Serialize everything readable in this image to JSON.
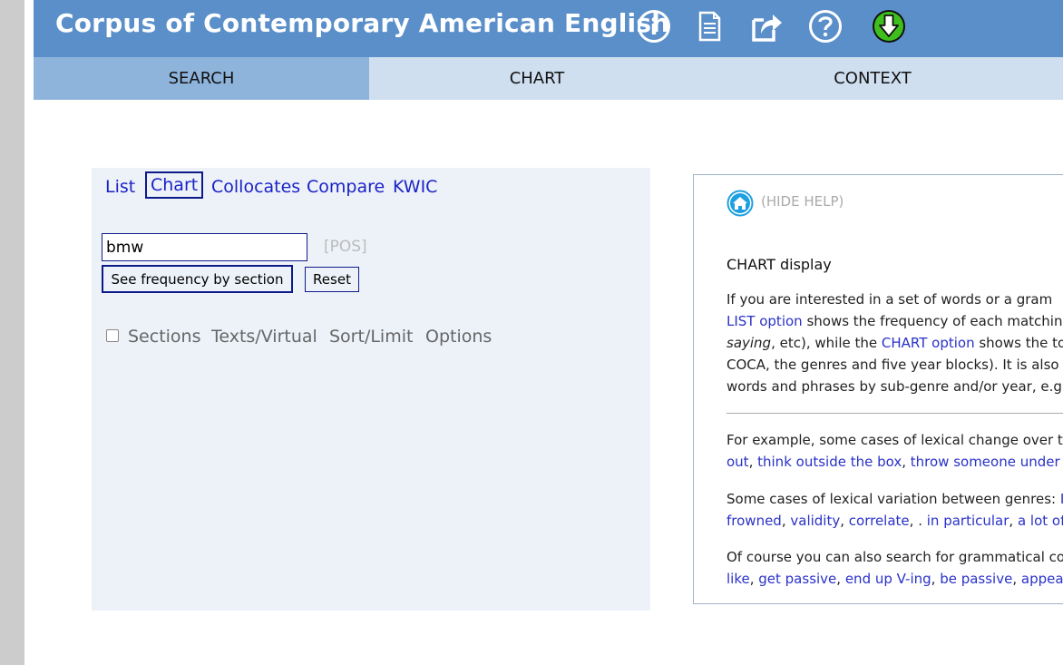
{
  "colors": {
    "header_bg": "#5a8fc9",
    "tab_bg": "#cfdff0",
    "tab_active_bg": "#8eb4dc",
    "panel_bg": "#edf2f9",
    "link": "#1a22c6",
    "info_green": "#3fbf1e"
  },
  "header": {
    "title": "Corpus of Contemporary American English",
    "icons": [
      "info-icon",
      "document-icon",
      "external-link-icon",
      "help-icon",
      "download-icon"
    ]
  },
  "tabs": [
    {
      "label": "SEARCH",
      "active": true
    },
    {
      "label": "CHART",
      "active": false
    },
    {
      "label": "CONTEXT",
      "active": false
    }
  ],
  "search": {
    "modes": [
      {
        "label": "List",
        "active": false
      },
      {
        "label": "Chart",
        "active": true
      },
      {
        "label": "Collocates",
        "active": false
      },
      {
        "label": "Compare",
        "active": false
      },
      {
        "label": "KWIC",
        "active": false
      }
    ],
    "query_value": "bmw",
    "pos_label": "[POS]",
    "submit_label": "See frequency by section",
    "reset_label": "Reset",
    "sections_checked": false,
    "options": [
      "Sections",
      "Texts/Virtual",
      "Sort/Limit",
      "Options"
    ]
  },
  "help": {
    "hide_label": "(HIDE HELP)",
    "title": "CHART display",
    "p1": {
      "line1": "If you are interested in a set of words or a gram",
      "line2_link": "LIST option",
      "line2_rest": " shows the frequency of each matchin",
      "line3_italic": "saying",
      "line3_mid": ", etc), while the ",
      "line3_link": "CHART option",
      "line3_rest": " shows the to",
      "line4": "COCA, the genres and five year blocks). It is also",
      "line5": "words and phrases by sub-genre and/or year, e.g"
    },
    "p2": {
      "line1": "For example, some cases of lexical change over ti",
      "link1": "out",
      "link2": "think outside the box",
      "link3": "throw someone under"
    },
    "p3": {
      "line1_text": "Some cases of lexical variation between genres: ",
      "line1_link": "I",
      "link1": "frowned",
      "link2": "validity",
      "link3": "correlate",
      "dot": ". ",
      "link4": "in particular",
      "link5": "a lot of,"
    },
    "p4": {
      "line1": "Of course you can also search for grammatical co",
      "link1": "like",
      "link2": "get passive",
      "link3": "end up V-ing",
      "link4": "be passive",
      "link5": "appear"
    }
  }
}
